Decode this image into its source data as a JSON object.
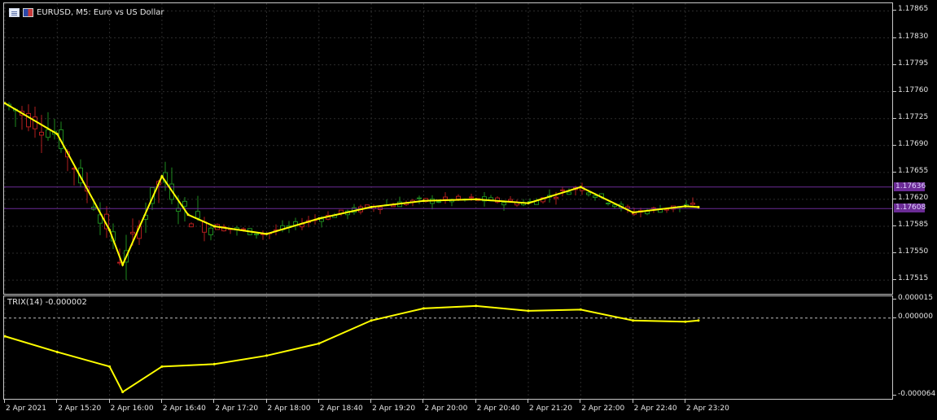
{
  "chart_title": "EURUSD, M5:  Euro vs US Dollar",
  "indicator_title": "TRIX(14) -0.000002",
  "colors": {
    "bull": "#1e8a1e",
    "bear": "#b01e1e",
    "ma_line": "#ffff00",
    "level_line": "#6b2b95",
    "grid": "#2c2c2c"
  },
  "price_axis": [
    "1.17865",
    "1.17830",
    "1.17795",
    "1.17760",
    "1.17725",
    "1.17690",
    "1.17655",
    "1.17620",
    "1.17585",
    "1.17550",
    "1.17515"
  ],
  "price_tags": [
    "1.17636",
    "1.17608"
  ],
  "indicator_axis": [
    "0.000015",
    "0.000000",
    "-0.000064"
  ],
  "time_axis": [
    "2 Apr 2021",
    "2 Apr 15:20",
    "2 Apr 16:00",
    "2 Apr 16:40",
    "2 Apr 17:20",
    "2 Apr 18:00",
    "2 Apr 18:40",
    "2 Apr 19:20",
    "2 Apr 20:00",
    "2 Apr 20:40",
    "2 Apr 21:20",
    "2 Apr 22:00",
    "2 Apr 22:40",
    "2 Apr 23:20"
  ],
  "chart_data": [
    {
      "type": "line",
      "title": "EURUSD, M5:  Euro vs US Dollar",
      "ylim": [
        1.17495,
        1.17875
      ],
      "level_lines": [
        1.17636,
        1.17608
      ],
      "x": [
        "2 Apr 14:40",
        "2 Apr 15:20",
        "2 Apr 16:00",
        "2 Apr 16:10",
        "2 Apr 16:40",
        "2 Apr 17:00",
        "2 Apr 17:20",
        "2 Apr 18:00",
        "2 Apr 18:40",
        "2 Apr 19:20",
        "2 Apr 20:00",
        "2 Apr 20:40",
        "2 Apr 21:20",
        "2 Apr 22:00",
        "2 Apr 22:40",
        "2 Apr 23:20",
        "2 Apr 23:30"
      ],
      "y": [
        1.17745,
        1.17705,
        1.1758,
        1.17535,
        1.1765,
        1.176,
        1.17585,
        1.17575,
        1.17595,
        1.1761,
        1.17618,
        1.1762,
        1.17615,
        1.17636,
        1.17603,
        1.17611,
        1.1761
      ]
    },
    {
      "type": "line",
      "title": "TRIX(14) -0.000002",
      "ylim": [
        -6.8e-05,
        1.8e-05
      ],
      "zero_line": 0.0,
      "x": [
        "2 Apr 14:40",
        "2 Apr 15:20",
        "2 Apr 16:00",
        "2 Apr 16:10",
        "2 Apr 16:40",
        "2 Apr 17:20",
        "2 Apr 18:00",
        "2 Apr 18:40",
        "2 Apr 19:20",
        "2 Apr 20:00",
        "2 Apr 20:40",
        "2 Apr 21:20",
        "2 Apr 22:00",
        "2 Apr 22:40",
        "2 Apr 23:20",
        "2 Apr 23:30"
      ],
      "y": [
        -1.5e-05,
        -2.8e-05,
        -4e-05,
        -6.1e-05,
        -4e-05,
        -3.8e-05,
        -3.1e-05,
        -2.1e-05,
        -2e-06,
        8e-06,
        1e-05,
        6e-06,
        7e-06,
        -2e-06,
        -3e-06,
        -2e-06
      ]
    }
  ]
}
